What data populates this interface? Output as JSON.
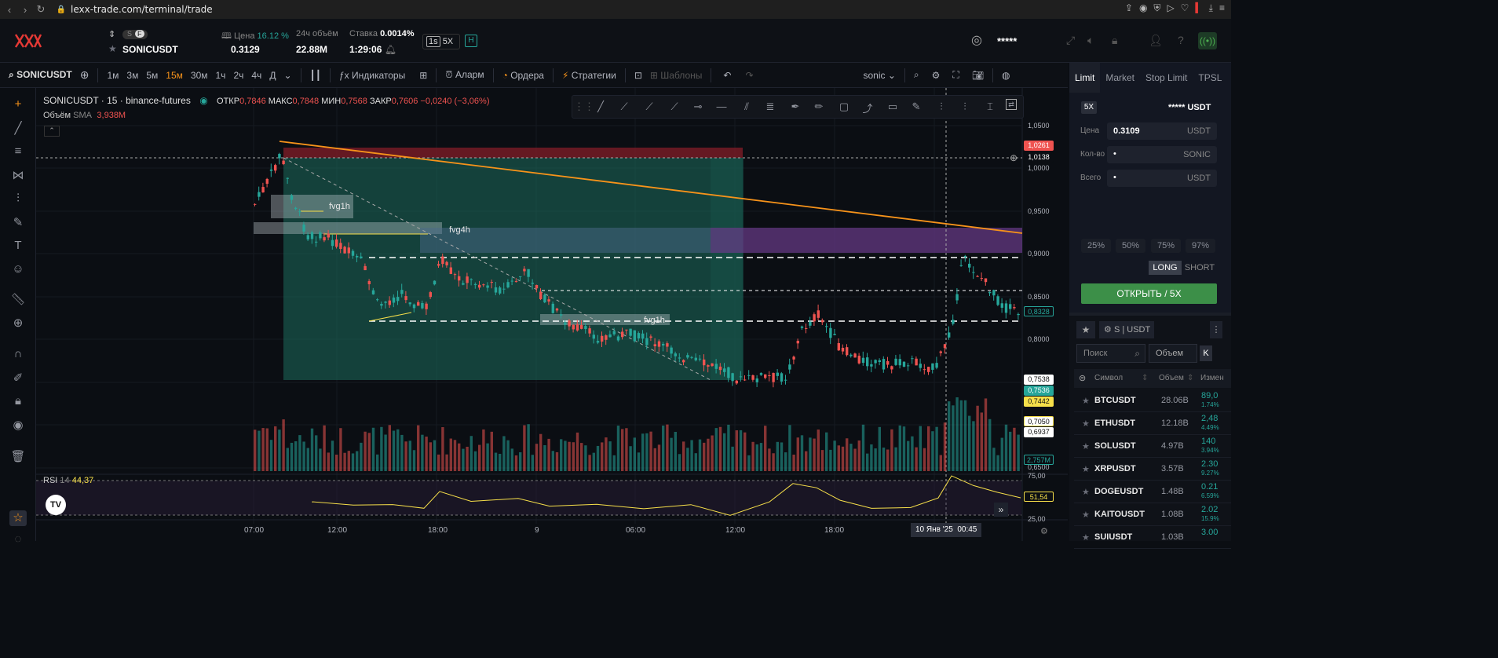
{
  "browser": {
    "url": "lexx-trade.com/terminal/trade",
    "back": "‹",
    "fwd": "›"
  },
  "header": {
    "symbol": "SONICUSDT",
    "mode_s": "S",
    "mode_f": "F",
    "price_label": "Цена",
    "price_change": "16.12 %",
    "price": "0.3129",
    "vol_label": "24ч объём",
    "volume": "22.88M",
    "rate_label": "Ставка",
    "rate": "0.0014%",
    "timer": "1:29:06",
    "interval_btn": "1s",
    "leverage": "5X",
    "h_btn": "H",
    "masked": "*****"
  },
  "toolbar": {
    "symbol": "SONICUSDT",
    "timeframes": [
      "1м",
      "3м",
      "5м",
      "15м",
      "30м",
      "1ч",
      "2ч",
      "4ч",
      "Д"
    ],
    "active_tf": "15м",
    "indicators": "Индикаторы",
    "alert": "Аларм",
    "orders": "Ордера",
    "strategies": "Стратегии",
    "templates": "Шаблоны",
    "search": "sonic"
  },
  "chart": {
    "title": "SONICUSDT · 15 · binance-futures",
    "o_label": "ОТКР",
    "o": "0,7846",
    "h_label": "МАКС",
    "h": "0,7848",
    "l_label": "МИН",
    "l": "0,7568",
    "c_label": "ЗАКР",
    "c": "0,7606",
    "chg": "−0,0240 (−3,06%)",
    "vol_label": "Объём",
    "vol_sma": "SMA",
    "vol_val": "3,938M",
    "fvg1": "fvg1h",
    "fvg2": "fvg4h",
    "fvg3": "fvg1h",
    "price_axis": [
      "1,0500",
      "1,0000",
      "0,9500",
      "0,9000",
      "0,8500",
      "0,8000",
      "0,6500"
    ],
    "price_tags": {
      "t1": "1,0261",
      "t2": "1,0138",
      "t3": "0,8328",
      "t4": "0,7538",
      "t5": "0,7536",
      "t6": "0,7442",
      "t7": "0,7050",
      "t8": "0,6937",
      "t9": "2,757M"
    },
    "rsi_label": "RSI",
    "rsi_len": "14",
    "rsi_val": "44,37",
    "rsi_tag": "51,54",
    "rsi_top": "75,00",
    "rsi_bot": "25,00",
    "time_axis": [
      "07:00",
      "12:00",
      "18:00",
      "9",
      "06:00",
      "12:00",
      "18:00"
    ],
    "crosshair_date": "10 Янв '25",
    "crosshair_time": "00:45",
    "tv_logo": "TV"
  },
  "order": {
    "tabs": [
      "Limit",
      "Market",
      "Stop Limit",
      "TPSL"
    ],
    "leverage": "5X",
    "balance": "***** USDT",
    "price_label": "Цена",
    "price_value": "0.3109",
    "price_unit": "USDT",
    "qty_label": "Кол-во",
    "qty_unit": "SONIC",
    "total_label": "Всего",
    "total_unit": "USDT",
    "pcts": [
      "25%",
      "50%",
      "75%",
      "97%"
    ],
    "long": "LONG",
    "short": "SHORT",
    "open": "ОТКРЫТЬ / 5X"
  },
  "market": {
    "filter": "S | USDT",
    "search_placeholder": "Поиск",
    "sort": "Объем",
    "sort_btn": "K",
    "col_symbol": "Символ",
    "col_vol": "Объем",
    "col_chg": "Измен",
    "rows": [
      {
        "sym": "BTCUSDT",
        "vol": "28.06B",
        "chg": "89,0",
        "chg2": "1.74%"
      },
      {
        "sym": "ETHUSDT",
        "vol": "12.18B",
        "chg": "2,48",
        "chg2": "4.49%"
      },
      {
        "sym": "SOLUSDT",
        "vol": "4.97B",
        "chg": "140",
        "chg2": "3.94%"
      },
      {
        "sym": "XRPUSDT",
        "vol": "3.57B",
        "chg": "2.30",
        "chg2": "9.27%"
      },
      {
        "sym": "DOGEUSDT",
        "vol": "1.48B",
        "chg": "0.21",
        "chg2": "6.59%"
      },
      {
        "sym": "KAITOUSDT",
        "vol": "1.08B",
        "chg": "2.02",
        "chg2": "15.9%"
      },
      {
        "sym": "SUIUSDT",
        "vol": "1.03B",
        "chg": "3.00",
        "chg2": ""
      }
    ]
  },
  "colors": {
    "up": "#26a69a",
    "down": "#ef5350",
    "accent": "#f7931a",
    "green_btn": "#3c8f48"
  }
}
